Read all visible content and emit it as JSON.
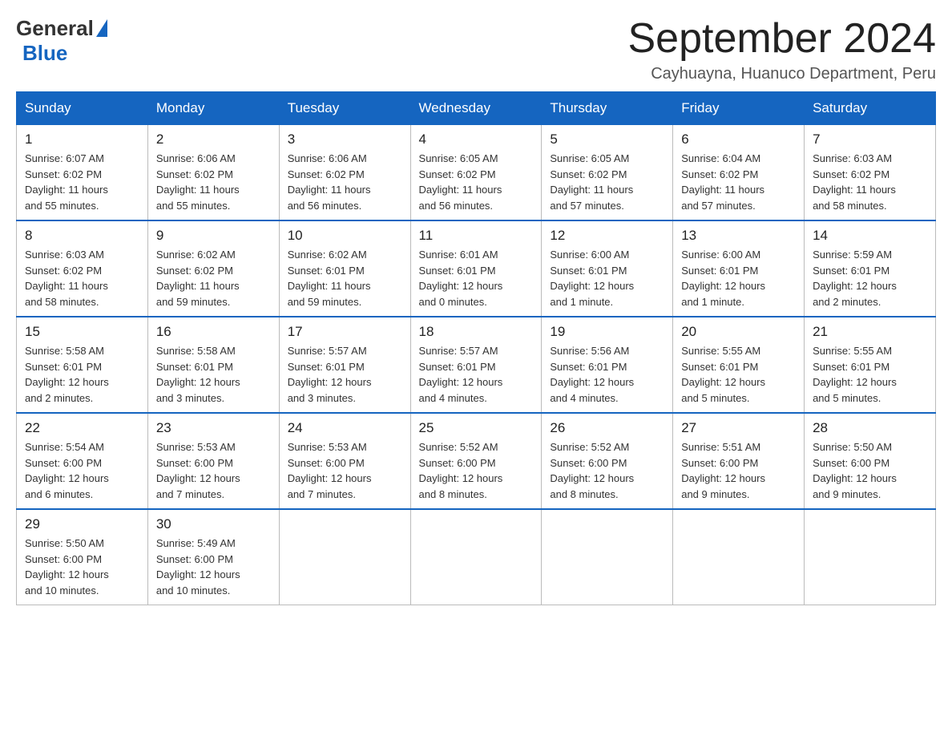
{
  "header": {
    "logo_general": "General",
    "logo_blue": "Blue",
    "month_title": "September 2024",
    "location": "Cayhuayna, Huanuco Department, Peru"
  },
  "days_of_week": [
    "Sunday",
    "Monday",
    "Tuesday",
    "Wednesday",
    "Thursday",
    "Friday",
    "Saturday"
  ],
  "weeks": [
    [
      {
        "day": "1",
        "info": "Sunrise: 6:07 AM\nSunset: 6:02 PM\nDaylight: 11 hours\nand 55 minutes."
      },
      {
        "day": "2",
        "info": "Sunrise: 6:06 AM\nSunset: 6:02 PM\nDaylight: 11 hours\nand 55 minutes."
      },
      {
        "day": "3",
        "info": "Sunrise: 6:06 AM\nSunset: 6:02 PM\nDaylight: 11 hours\nand 56 minutes."
      },
      {
        "day": "4",
        "info": "Sunrise: 6:05 AM\nSunset: 6:02 PM\nDaylight: 11 hours\nand 56 minutes."
      },
      {
        "day": "5",
        "info": "Sunrise: 6:05 AM\nSunset: 6:02 PM\nDaylight: 11 hours\nand 57 minutes."
      },
      {
        "day": "6",
        "info": "Sunrise: 6:04 AM\nSunset: 6:02 PM\nDaylight: 11 hours\nand 57 minutes."
      },
      {
        "day": "7",
        "info": "Sunrise: 6:03 AM\nSunset: 6:02 PM\nDaylight: 11 hours\nand 58 minutes."
      }
    ],
    [
      {
        "day": "8",
        "info": "Sunrise: 6:03 AM\nSunset: 6:02 PM\nDaylight: 11 hours\nand 58 minutes."
      },
      {
        "day": "9",
        "info": "Sunrise: 6:02 AM\nSunset: 6:02 PM\nDaylight: 11 hours\nand 59 minutes."
      },
      {
        "day": "10",
        "info": "Sunrise: 6:02 AM\nSunset: 6:01 PM\nDaylight: 11 hours\nand 59 minutes."
      },
      {
        "day": "11",
        "info": "Sunrise: 6:01 AM\nSunset: 6:01 PM\nDaylight: 12 hours\nand 0 minutes."
      },
      {
        "day": "12",
        "info": "Sunrise: 6:00 AM\nSunset: 6:01 PM\nDaylight: 12 hours\nand 1 minute."
      },
      {
        "day": "13",
        "info": "Sunrise: 6:00 AM\nSunset: 6:01 PM\nDaylight: 12 hours\nand 1 minute."
      },
      {
        "day": "14",
        "info": "Sunrise: 5:59 AM\nSunset: 6:01 PM\nDaylight: 12 hours\nand 2 minutes."
      }
    ],
    [
      {
        "day": "15",
        "info": "Sunrise: 5:58 AM\nSunset: 6:01 PM\nDaylight: 12 hours\nand 2 minutes."
      },
      {
        "day": "16",
        "info": "Sunrise: 5:58 AM\nSunset: 6:01 PM\nDaylight: 12 hours\nand 3 minutes."
      },
      {
        "day": "17",
        "info": "Sunrise: 5:57 AM\nSunset: 6:01 PM\nDaylight: 12 hours\nand 3 minutes."
      },
      {
        "day": "18",
        "info": "Sunrise: 5:57 AM\nSunset: 6:01 PM\nDaylight: 12 hours\nand 4 minutes."
      },
      {
        "day": "19",
        "info": "Sunrise: 5:56 AM\nSunset: 6:01 PM\nDaylight: 12 hours\nand 4 minutes."
      },
      {
        "day": "20",
        "info": "Sunrise: 5:55 AM\nSunset: 6:01 PM\nDaylight: 12 hours\nand 5 minutes."
      },
      {
        "day": "21",
        "info": "Sunrise: 5:55 AM\nSunset: 6:01 PM\nDaylight: 12 hours\nand 5 minutes."
      }
    ],
    [
      {
        "day": "22",
        "info": "Sunrise: 5:54 AM\nSunset: 6:00 PM\nDaylight: 12 hours\nand 6 minutes."
      },
      {
        "day": "23",
        "info": "Sunrise: 5:53 AM\nSunset: 6:00 PM\nDaylight: 12 hours\nand 7 minutes."
      },
      {
        "day": "24",
        "info": "Sunrise: 5:53 AM\nSunset: 6:00 PM\nDaylight: 12 hours\nand 7 minutes."
      },
      {
        "day": "25",
        "info": "Sunrise: 5:52 AM\nSunset: 6:00 PM\nDaylight: 12 hours\nand 8 minutes."
      },
      {
        "day": "26",
        "info": "Sunrise: 5:52 AM\nSunset: 6:00 PM\nDaylight: 12 hours\nand 8 minutes."
      },
      {
        "day": "27",
        "info": "Sunrise: 5:51 AM\nSunset: 6:00 PM\nDaylight: 12 hours\nand 9 minutes."
      },
      {
        "day": "28",
        "info": "Sunrise: 5:50 AM\nSunset: 6:00 PM\nDaylight: 12 hours\nand 9 minutes."
      }
    ],
    [
      {
        "day": "29",
        "info": "Sunrise: 5:50 AM\nSunset: 6:00 PM\nDaylight: 12 hours\nand 10 minutes."
      },
      {
        "day": "30",
        "info": "Sunrise: 5:49 AM\nSunset: 6:00 PM\nDaylight: 12 hours\nand 10 minutes."
      },
      {
        "day": "",
        "info": ""
      },
      {
        "day": "",
        "info": ""
      },
      {
        "day": "",
        "info": ""
      },
      {
        "day": "",
        "info": ""
      },
      {
        "day": "",
        "info": ""
      }
    ]
  ]
}
